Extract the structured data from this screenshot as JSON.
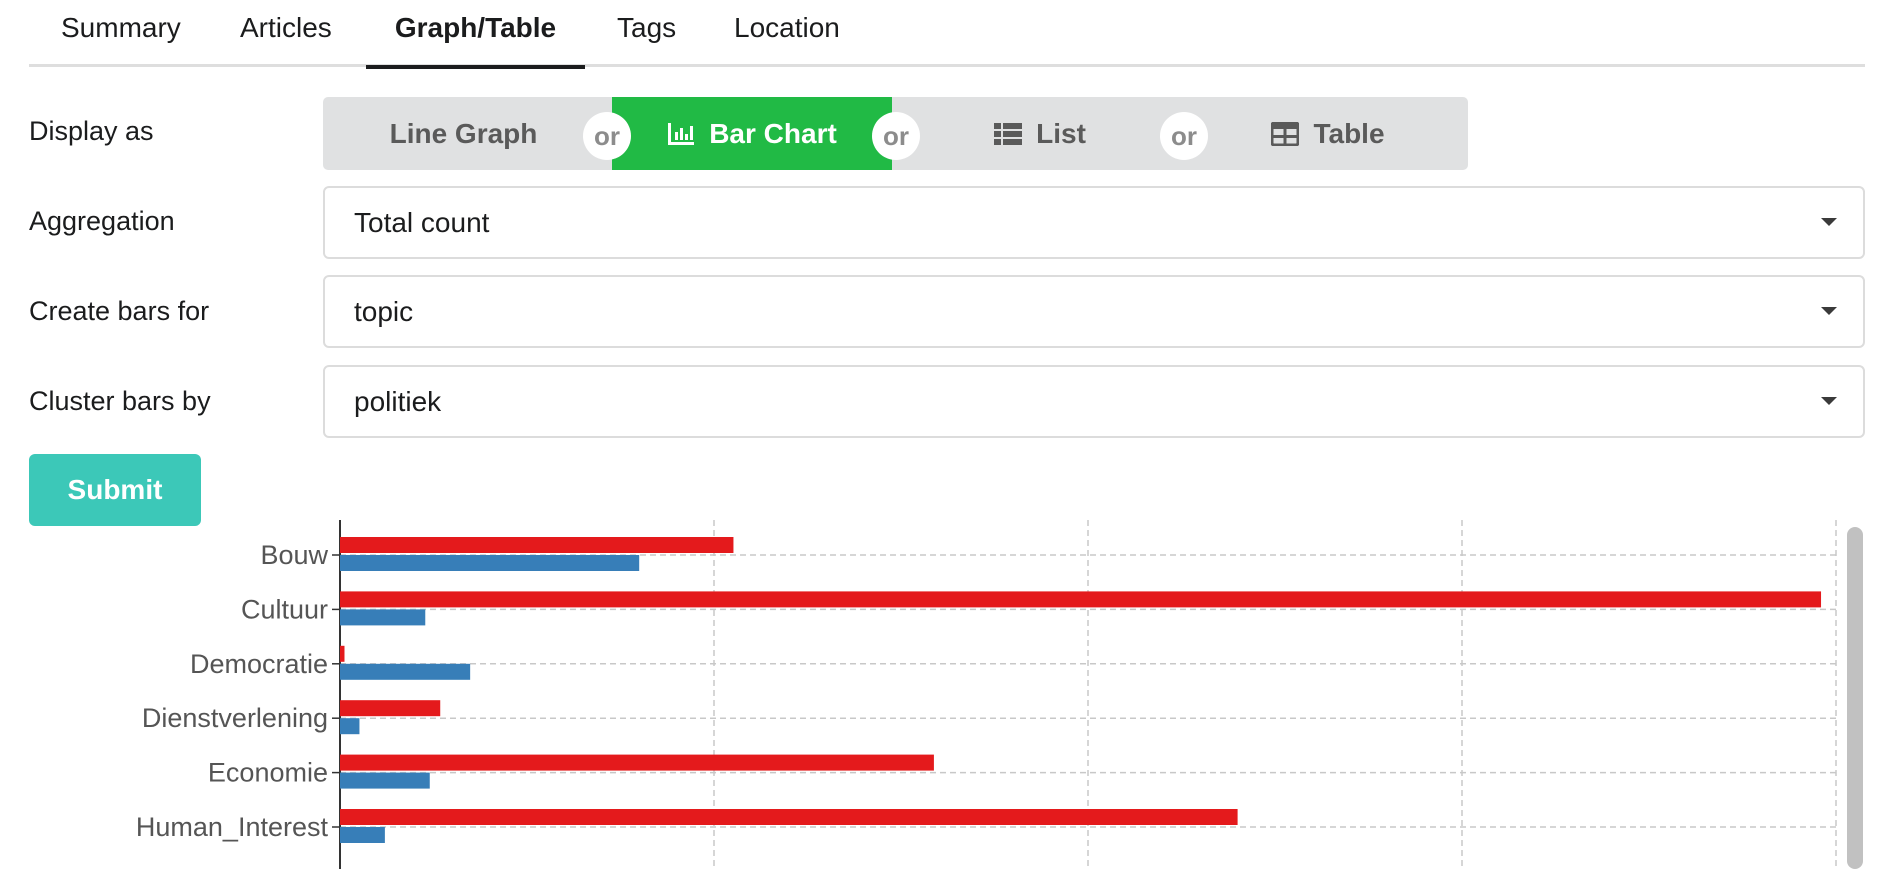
{
  "tabs": [
    {
      "label": "Summary",
      "active": false
    },
    {
      "label": "Articles",
      "active": false
    },
    {
      "label": "Graph/Table",
      "active": true
    },
    {
      "label": "Tags",
      "active": false
    },
    {
      "label": "Location",
      "active": false
    }
  ],
  "form": {
    "display_label": "Display as",
    "display_options": [
      {
        "label": "Line Graph",
        "icon": "none",
        "active": false
      },
      {
        "label": "Bar Chart",
        "icon": "bar-chart-icon",
        "active": true
      },
      {
        "label": "List",
        "icon": "list-icon",
        "active": false
      },
      {
        "label": "Table",
        "icon": "table-icon",
        "active": false
      }
    ],
    "or_text": "or",
    "aggregation_label": "Aggregation",
    "aggregation_value": "Total count",
    "bars_label": "Create bars for",
    "bars_value": "topic",
    "cluster_label": "Cluster bars by",
    "cluster_value": "politiek",
    "submit_label": "Submit"
  },
  "colors": {
    "active_button": "#21ba45",
    "submit_button": "#3cc8b8",
    "series_red": "#e41a1c",
    "series_blue": "#377eb8"
  },
  "chart_data": {
    "type": "bar",
    "orientation": "horizontal",
    "grid": true,
    "xlim": [
      0,
      1
    ],
    "categories": [
      "Bouw",
      "Cultuur",
      "Democratie",
      "Dienstverlening",
      "Economie",
      "Human_Interest"
    ],
    "series": [
      {
        "values": [
          0.263,
          0.99,
          0.003,
          0.067,
          0.397,
          0.6
        ],
        "color": "#e41a1c"
      },
      {
        "values": [
          0.2,
          0.057,
          0.087,
          0.013,
          0.06,
          0.03
        ],
        "color": "#377eb8"
      }
    ]
  }
}
